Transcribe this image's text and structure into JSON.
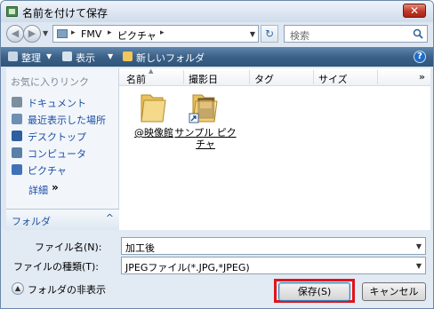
{
  "window": {
    "title": "名前を付けて保存",
    "close_label": "✕"
  },
  "nav": {
    "back_icon": "back-arrow-icon",
    "forward_icon": "forward-arrow-icon",
    "breadcrumb": [
      "FMV",
      "ピクチャ"
    ],
    "search_placeholder": "検索"
  },
  "toolbar": {
    "organize_label": "整理",
    "views_label": "表示",
    "new_folder_label": "新しいフォルダ",
    "help_label": "?"
  },
  "sidebar": {
    "heading": "お気に入りリンク",
    "items": [
      {
        "label": "ドキュメント",
        "icon": "documents-icon",
        "color": "#7d8f9f"
      },
      {
        "label": "最近表示した場所",
        "icon": "recent-places-icon",
        "color": "#6e8fb2"
      },
      {
        "label": "デスクトップ",
        "icon": "desktop-icon",
        "color": "#2f5f9e"
      },
      {
        "label": "コンピュータ",
        "icon": "computer-icon",
        "color": "#5a7fa8"
      },
      {
        "label": "ピクチャ",
        "icon": "pictures-icon",
        "color": "#3f72b7"
      }
    ],
    "details_label": "詳細",
    "details_chevron": "»",
    "folders_label": "フォルダ",
    "folders_chevron": "^"
  },
  "filelist": {
    "columns": [
      "名前",
      "撮影日",
      "タグ",
      "サイズ"
    ],
    "more_columns": "»",
    "items": [
      {
        "label": "@映像館",
        "icon": "folder-icon"
      },
      {
        "label": "サンプル ピクチャ",
        "icon": "folder-shortcut-icon"
      }
    ]
  },
  "form": {
    "filename_label": "ファイル名(N):",
    "filename_value": "加工後",
    "filetype_label": "ファイルの種類(T):",
    "filetype_value": "JPEGファイル(*.JPG,*JPEG)"
  },
  "footer": {
    "hide_folders_label": "フォルダの非表示",
    "save_label": "保存(S)",
    "cancel_label": "キャンセル"
  },
  "colors": {
    "highlight": "#e1141b",
    "toolbar": "#3c6188",
    "link": "#1d4ea2"
  }
}
